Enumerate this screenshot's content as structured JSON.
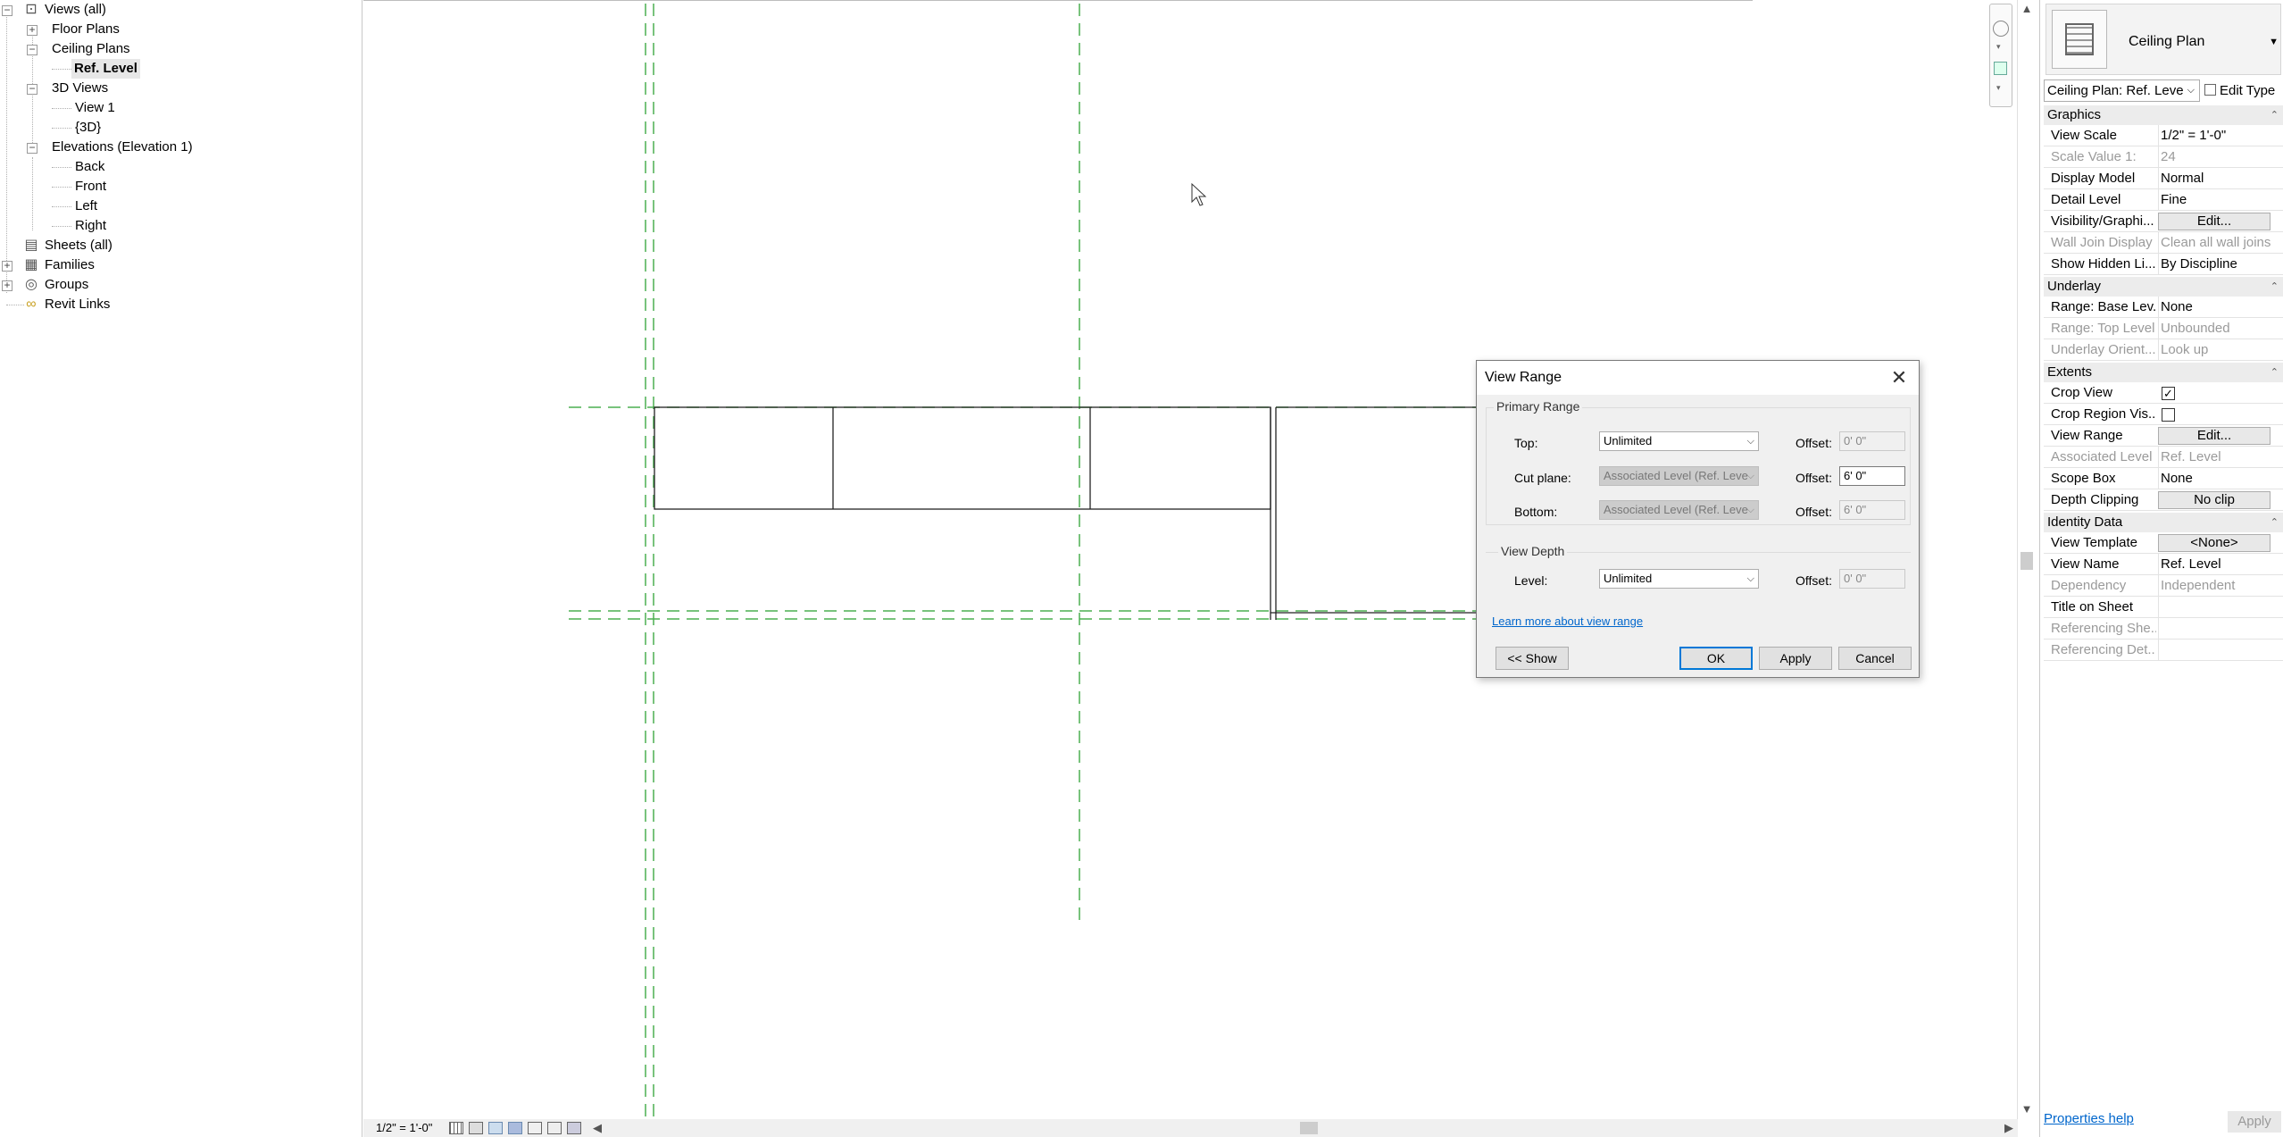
{
  "browser": {
    "views_all": "Views (all)",
    "floor_plans": "Floor Plans",
    "ceiling_plans": "Ceiling Plans",
    "ref_level": "Ref. Level",
    "views_3d": "3D Views",
    "view1": "View 1",
    "view_3d": "{3D}",
    "elevations": "Elevations (Elevation 1)",
    "back": "Back",
    "front": "Front",
    "left": "Left",
    "right": "Right",
    "sheets": "Sheets (all)",
    "families": "Families",
    "groups": "Groups",
    "revit_links": "Revit Links"
  },
  "status": {
    "scale": "1/2\" = 1'-0\""
  },
  "dialog": {
    "title": "View Range",
    "close": "✕",
    "primary_range": "Primary Range",
    "top_label": "Top:",
    "top_value": "Unlimited",
    "top_offset_label": "Offset:",
    "top_offset": "0'  0\"",
    "cut_label": "Cut plane:",
    "cut_value": "Associated Level (Ref. Leve",
    "cut_offset_label": "Offset:",
    "cut_offset": "6'  0\"",
    "bottom_label": "Bottom:",
    "bottom_value": "Associated Level (Ref. Leve",
    "bottom_offset_label": "Offset:",
    "bottom_offset": "6'  0\"",
    "view_depth": "View Depth",
    "level_label": "Level:",
    "level_value": "Unlimited",
    "level_offset_label": "Offset:",
    "level_offset": "0'  0\"",
    "learn_more": "Learn more about view range",
    "show_button": "<< Show",
    "ok_button": "OK",
    "apply_button": "Apply",
    "cancel_button": "Cancel"
  },
  "props": {
    "type_name": "Ceiling Plan",
    "instance_selector": "Ceiling Plan: Ref. Leve",
    "edit_type": "Edit Type",
    "sections": {
      "graphics": "Graphics",
      "underlay": "Underlay",
      "extents": "Extents",
      "identity": "Identity Data"
    },
    "rows": {
      "view_scale": {
        "name": "View Scale",
        "value": "1/2\" = 1'-0\""
      },
      "scale_value": {
        "name": "Scale Value    1:",
        "value": "24"
      },
      "display_model": {
        "name": "Display Model",
        "value": "Normal"
      },
      "detail_level": {
        "name": "Detail Level",
        "value": "Fine"
      },
      "visibility": {
        "name": "Visibility/Graphi...",
        "value": "Edit..."
      },
      "wall_join": {
        "name": "Wall Join Display",
        "value": "Clean all wall joins"
      },
      "hidden_lines": {
        "name": "Show Hidden Li...",
        "value": "By Discipline"
      },
      "range_base": {
        "name": "Range: Base Lev...",
        "value": "None"
      },
      "range_top": {
        "name": "Range: Top Level",
        "value": "Unbounded"
      },
      "underlay_orient": {
        "name": "Underlay Orient...",
        "value": "Look up"
      },
      "crop_view": {
        "name": "Crop View",
        "value": "✓"
      },
      "crop_region": {
        "name": "Crop Region Vis...",
        "value": ""
      },
      "view_range": {
        "name": "View Range",
        "value": "Edit..."
      },
      "assoc_level": {
        "name": "Associated Level",
        "value": "Ref. Level"
      },
      "scope_box": {
        "name": "Scope Box",
        "value": "None"
      },
      "depth_clipping": {
        "name": "Depth Clipping",
        "value": "No clip"
      },
      "view_template": {
        "name": "View Template",
        "value": "<None>"
      },
      "view_name": {
        "name": "View Name",
        "value": "Ref. Level"
      },
      "dependency": {
        "name": "Dependency",
        "value": "Independent"
      },
      "title_on_sheet": {
        "name": "Title on Sheet",
        "value": ""
      },
      "ref_sheet": {
        "name": "Referencing She...",
        "value": ""
      },
      "ref_detail": {
        "name": "Referencing Det...",
        "value": ""
      }
    },
    "help_link": "Properties help",
    "apply": "Apply"
  },
  "colors": {
    "grid_line": "#4caf50",
    "accent": "#0078d7"
  }
}
